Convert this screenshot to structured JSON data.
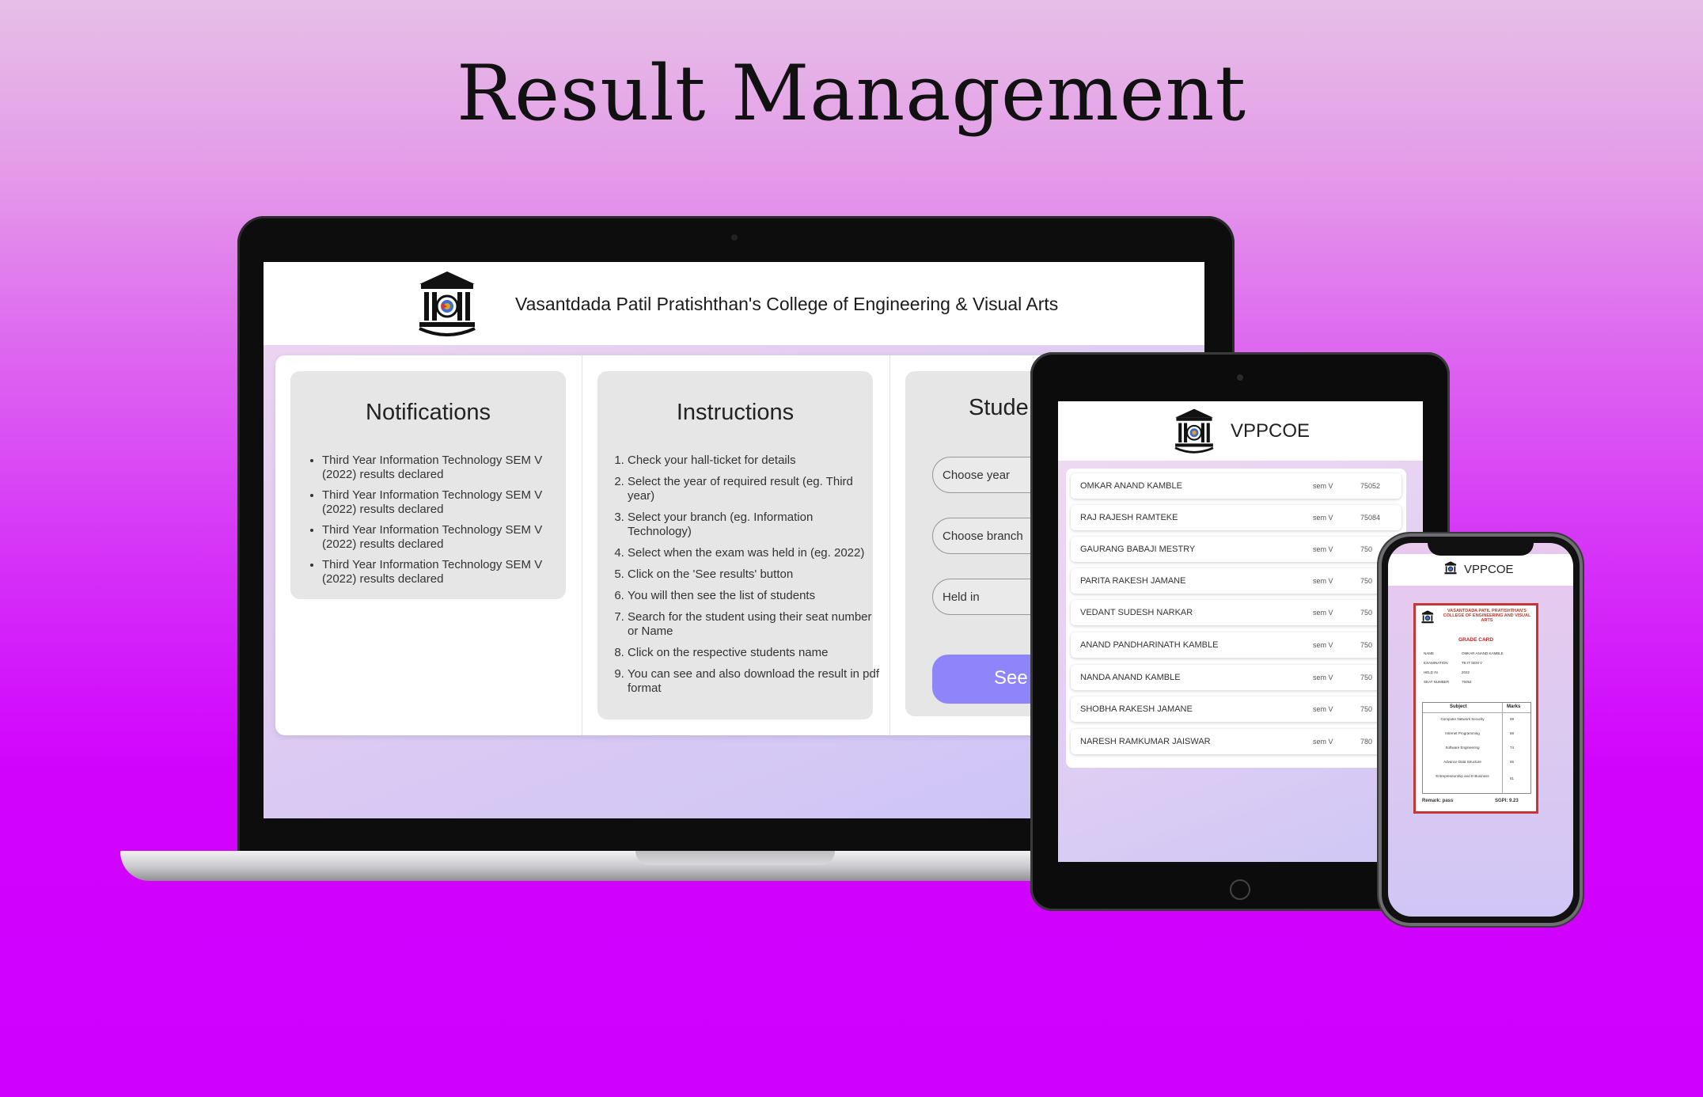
{
  "page_title": "Result Management",
  "college": {
    "full_name": "Vasantdada Patil Pratishthan's College of Engineering & Visual Arts",
    "short_name": "VPPCOE"
  },
  "notifications": {
    "heading": "Notifications",
    "items": [
      "Third Year Information Technology SEM V (2022) results declared",
      "Third Year Information Technology SEM V (2022) results declared",
      "Third Year Information Technology SEM V (2022) results declared",
      "Third Year Information Technology SEM V (2022) results declared"
    ]
  },
  "instructions": {
    "heading": "Instructions",
    "items": [
      "Check your hall-ticket for details",
      "Select the year of required result (eg. Third year)",
      "Select your branch (eg. Information Technology)",
      "Select when the exam was held in (eg. 2022)",
      "Click on the 'See results' button",
      "You will then see the list of students",
      "Search for the student using their seat number or Name",
      "Click on the respective students name",
      "You can see and also download the result in pdf format"
    ]
  },
  "student": {
    "heading": "Stude",
    "year_placeholder": "Choose year",
    "branch_placeholder": "Choose branch",
    "held_placeholder": "Held in",
    "see_label": "See"
  },
  "student_list": [
    {
      "name": "OMKAR ANAND KAMBLE",
      "sem": "sem V",
      "seat": "75052"
    },
    {
      "name": "RAJ RAJESH RAMTEKE",
      "sem": "sem V",
      "seat": "75084"
    },
    {
      "name": "GAURANG BABAJI MESTRY",
      "sem": "sem V",
      "seat": "750"
    },
    {
      "name": "PARITA RAKESH JAMANE",
      "sem": "sem V",
      "seat": "750"
    },
    {
      "name": "VEDANT SUDESH NARKAR",
      "sem": "sem V",
      "seat": "750"
    },
    {
      "name": "ANAND PANDHARINATH KAMBLE",
      "sem": "sem V",
      "seat": "750"
    },
    {
      "name": "NANDA ANAND KAMBLE",
      "sem": "sem V",
      "seat": "750"
    },
    {
      "name": "SHOBHA RAKESH JAMANE",
      "sem": "sem V",
      "seat": "750"
    },
    {
      "name": "NARESH RAMKUMAR JAISWAR",
      "sem": "sem V",
      "seat": "780"
    }
  ],
  "grade_card": {
    "college": "VASANTDADA PATIL PRATISHTHAN'S COLLEGE OF ENGINEERING AND VISUAL ARTS",
    "title": "GRADE CARD",
    "info": [
      {
        "label": "NAME",
        "value": "OMKAR ANAND KAMBLE"
      },
      {
        "label": "EXAMINATION",
        "value": "TE IT SEM V"
      },
      {
        "label": "HELD IN",
        "value": "2022"
      },
      {
        "label": "SEAT NUMBER",
        "value": "75052"
      }
    ],
    "col_subject": "Subject",
    "col_marks": "Marks",
    "subjects": [
      {
        "name": "Computer Network Security",
        "marks": "69"
      },
      {
        "name": "Internet Programming",
        "marks": "68"
      },
      {
        "name": "Software Engineering",
        "marks": "74"
      },
      {
        "name": "Advance Data Structure",
        "marks": "66"
      },
      {
        "name": "Entrepreneurship and E-Business",
        "marks": "61"
      }
    ],
    "remark": "Remark: pass",
    "sgpi": "SGPI: 9.23"
  },
  "colors": {
    "accent_button": "#8f85fb",
    "grade_border": "#c83535"
  }
}
